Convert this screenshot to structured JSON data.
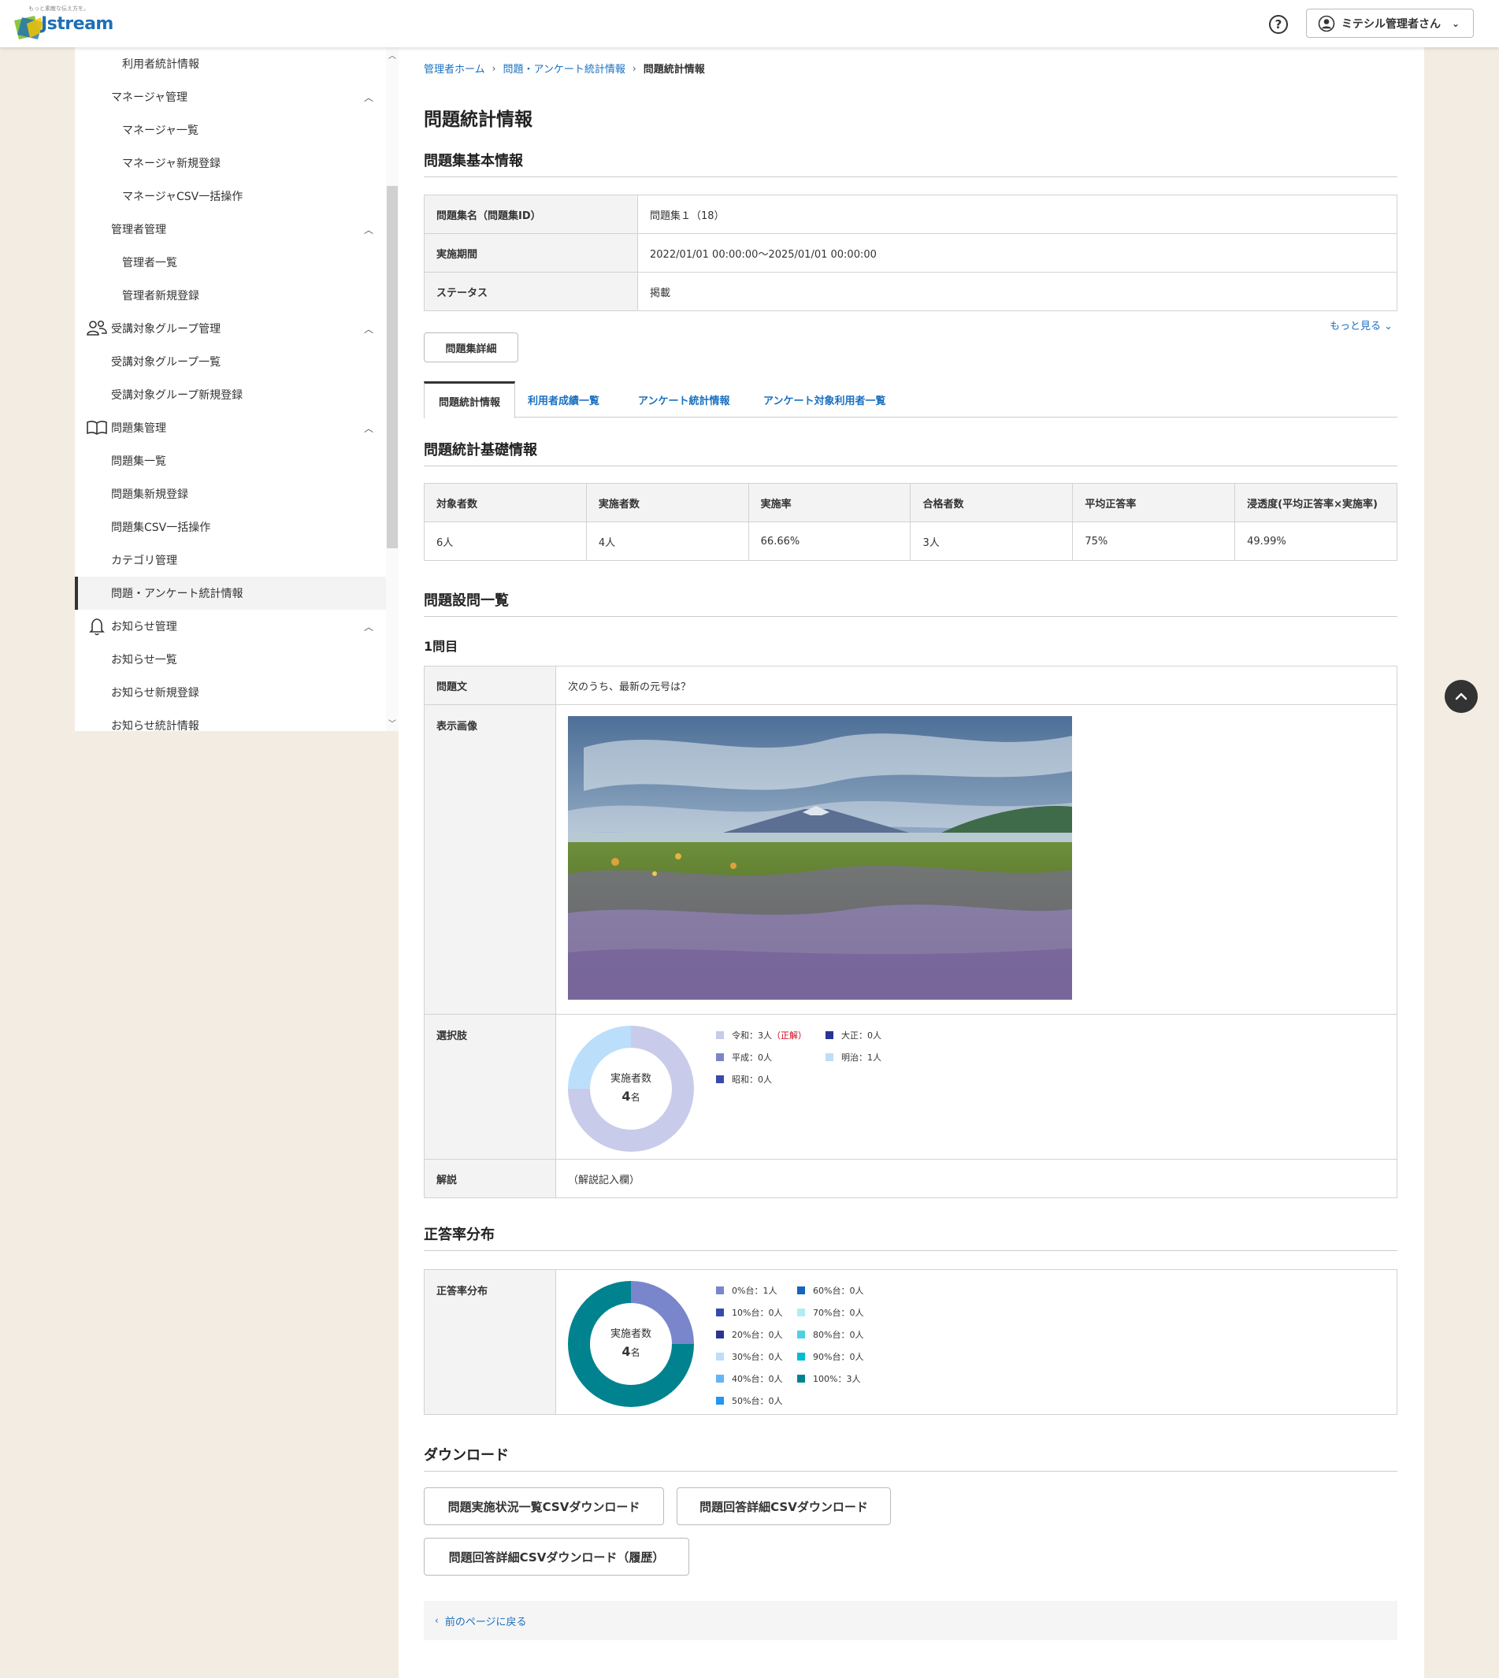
{
  "header": {
    "logo_tagline": "もっと素敵な伝え方を。",
    "logo_text": "Jstream",
    "help_label": "?",
    "user_name": "ミテシル管理者さん"
  },
  "sidebar": {
    "items": [
      {
        "label": "利用者統計情報"
      },
      {
        "label": "マネージャ管理"
      },
      {
        "label": "マネージャ一覧"
      },
      {
        "label": "マネージャ新規登録"
      },
      {
        "label": "マネージャCSV一括操作"
      },
      {
        "label": "管理者管理"
      },
      {
        "label": "管理者一覧"
      },
      {
        "label": "管理者新規登録"
      },
      {
        "label": "受講対象グループ管理"
      },
      {
        "label": "受講対象グループ一覧"
      },
      {
        "label": "受講対象グループ新規登録"
      },
      {
        "label": "問題集管理"
      },
      {
        "label": "問題集一覧"
      },
      {
        "label": "問題集新規登録"
      },
      {
        "label": "問題集CSV一括操作"
      },
      {
        "label": "カテゴリ管理"
      },
      {
        "label": "問題・アンケート統計情報"
      },
      {
        "label": "お知らせ管理"
      },
      {
        "label": "お知らせ一覧"
      },
      {
        "label": "お知らせ新規登録"
      },
      {
        "label": "お知らせ統計情報"
      }
    ]
  },
  "breadcrumb": {
    "home": "管理者ホーム",
    "parent": "問題・アンケート統計情報",
    "current": "問題統計情報"
  },
  "page_title": "問題統計情報",
  "basic_info": {
    "title": "問題集基本情報",
    "rows": [
      {
        "key": "問題集名（問題集ID）",
        "value": "問題集１（18）"
      },
      {
        "key": "実施期間",
        "value": "2022/01/01 00:00:00〜2025/01/01 00:00:00"
      },
      {
        "key": "ステータス",
        "value": "掲載"
      }
    ],
    "more_label": "もっと見る",
    "detail_button": "問題集詳細"
  },
  "tabs": [
    {
      "label": "問題統計情報"
    },
    {
      "label": "利用者成績一覧"
    },
    {
      "label": "アンケート統計情報"
    },
    {
      "label": "アンケート対象利用者一覧"
    }
  ],
  "stats": {
    "title": "問題統計基礎情報",
    "headers": [
      "対象者数",
      "実施者数",
      "実施率",
      "合格者数",
      "平均正答率",
      "浸透度(平均正答率×実施率)"
    ],
    "values": [
      "6人",
      "4人",
      "66.66%",
      "3人",
      "75%",
      "49.99%"
    ]
  },
  "questions": {
    "title": "問題設問一覧",
    "number": "1問目",
    "label_text": "問題文",
    "text": "次のうち、最新の元号は？",
    "label_image": "表示画像",
    "label_choices": "選択肢",
    "donut_label": "実施者数",
    "donut_value": "4",
    "donut_unit": "名",
    "choices": [
      {
        "label": "令和：3人",
        "suffix": "（正解）",
        "color": "#c8cbe9",
        "count": 3
      },
      {
        "label": "大正：0人",
        "suffix": "",
        "color": "#283593",
        "count": 0
      },
      {
        "label": "平成：0人",
        "suffix": "",
        "color": "#7986cb",
        "count": 0
      },
      {
        "label": "明治：1人",
        "suffix": "",
        "color": "#bbdefb",
        "count": 1
      },
      {
        "label": "昭和：0人",
        "suffix": "",
        "color": "#3949ab",
        "count": 0
      }
    ],
    "label_explanation": "解説",
    "explanation": "（解説記入欄）"
  },
  "distribution": {
    "title": "正答率分布",
    "row_label": "正答率分布",
    "donut_label": "実施者数",
    "donut_value": "4",
    "donut_unit": "名",
    "items": [
      {
        "label": "0%台：1人",
        "color": "#7986cb",
        "count": 1
      },
      {
        "label": "10%台：0人",
        "color": "#3949ab",
        "count": 0
      },
      {
        "label": "20%台：0人",
        "color": "#283593",
        "count": 0
      },
      {
        "label": "30%台：0人",
        "color": "#bbdefb",
        "count": 0
      },
      {
        "label": "40%台：0人",
        "color": "#64b5f6",
        "count": 0
      },
      {
        "label": "50%台：0人",
        "color": "#2196f3",
        "count": 0
      },
      {
        "label": "60%台：0人",
        "color": "#1565c0",
        "count": 0
      },
      {
        "label": "70%台：0人",
        "color": "#b2ebf2",
        "count": 0
      },
      {
        "label": "80%台：0人",
        "color": "#4dd0e1",
        "count": 0
      },
      {
        "label": "90%台：0人",
        "color": "#00bcd4",
        "count": 0
      },
      {
        "label": "100%：3人",
        "color": "#00838f",
        "count": 3
      }
    ]
  },
  "download": {
    "title": "ダウンロード",
    "buttons": [
      {
        "label": "問題実施状況一覧CSVダウンロード"
      },
      {
        "label": "問題回答詳細CSVダウンロード"
      },
      {
        "label": "問題回答詳細CSVダウンロード（履歴）"
      }
    ]
  },
  "back_link": "前のページに戻る"
}
